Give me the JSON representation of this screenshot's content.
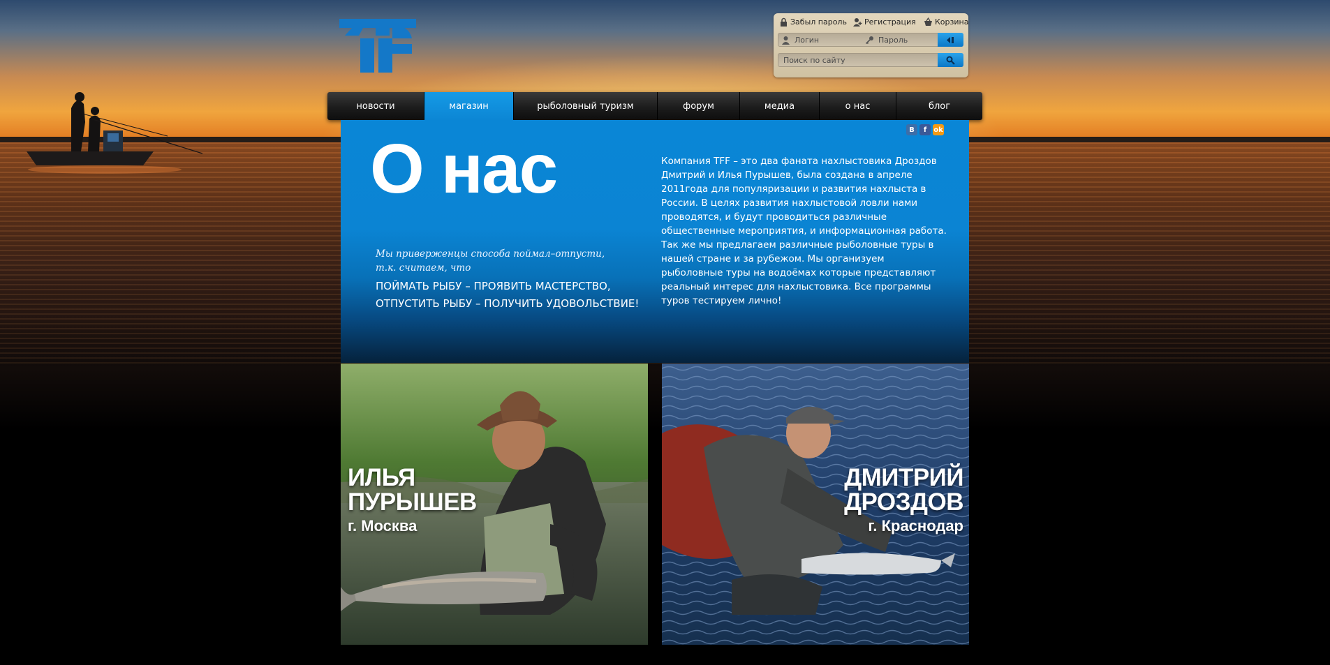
{
  "header": {
    "links": [
      {
        "label": "Забыл пароль",
        "icon": "lock-icon"
      },
      {
        "label": "Регистрация",
        "icon": "user-plus-icon"
      },
      {
        "label": "Корзина",
        "icon": "basket-icon"
      }
    ],
    "login_placeholder": "Логин",
    "password_placeholder": "Пароль",
    "search_placeholder": "Поиск по сайту"
  },
  "nav": [
    {
      "label": "новости"
    },
    {
      "label": "магазин",
      "active": true
    },
    {
      "label": "рыболовный туризм"
    },
    {
      "label": "форум"
    },
    {
      "label": "медиа"
    },
    {
      "label": "о нас"
    },
    {
      "label": "блог"
    }
  ],
  "share": [
    {
      "label": "B",
      "color": "#3d6ea8"
    },
    {
      "label": "f",
      "color": "#3b5998"
    },
    {
      "label": "ok",
      "color": "#f59a12"
    }
  ],
  "main": {
    "title": "О нас",
    "motto_italic": "Мы приверженцы способа поймал–отпусти, т.к. считаем, что",
    "motto_line1": "ПОЙМАТЬ РЫБУ – ПРОЯВИТЬ МАСТЕРСТВО,",
    "motto_line2": "ОТПУСТИТЬ РЫБУ – ПОЛУЧИТЬ УДОВОЛЬСТВИЕ!",
    "about": "Компания TFF – это два фаната нахлыстовика Дроздов Дмитрий и Илья Пурышев, была создана в апреле 2011года для популяризации и развития нахлыста в России. В целях развития нахлыстовой ловли нами проводятся, и будут проводиться различные общественные мероприятия, и информационная работа. Так же мы предлагаем различные рыболовные туры в нашей стране и за рубежом. Мы организуем рыболовные туры на водоёмах которые представляют реальный интерес для нахлыстовика. Все программы туров тестируем лично!"
  },
  "people": [
    {
      "first": "ИЛЬЯ",
      "last": "ПУРЫШЕВ",
      "city": "г. Москва"
    },
    {
      "first": "ДМИТРИЙ",
      "last": "ДРОЗДОВ",
      "city": "г. Краснодар"
    }
  ],
  "colors": {
    "accent": "#0c86d4",
    "logo": "#1478c8"
  }
}
